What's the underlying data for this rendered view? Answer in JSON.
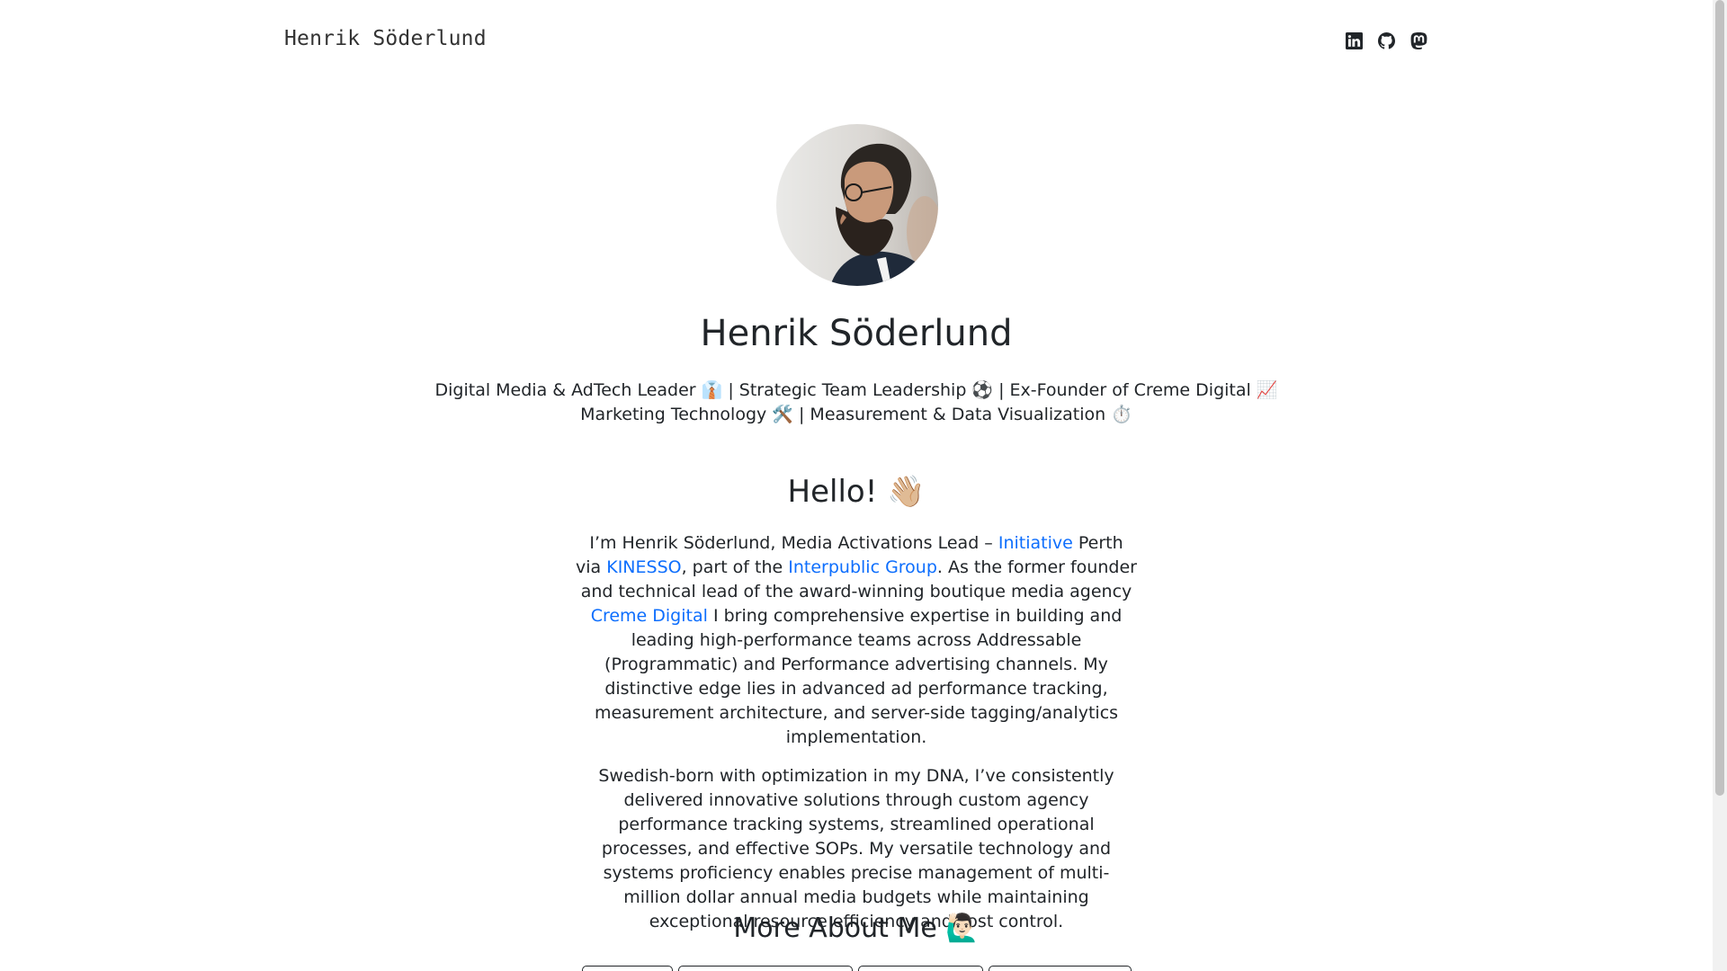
{
  "header": {
    "site_title": "Henrik Söderlund",
    "social": [
      {
        "icon": "linkedin-icon"
      },
      {
        "icon": "github-icon"
      },
      {
        "icon": "mastodon-icon"
      }
    ]
  },
  "hero": {
    "name": "Henrik Söderlund",
    "tagline_line1": "Digital Media & AdTech Leader 👔 | Strategic Team Leadership ⚽ | Ex-Founder of Creme Digital 📈",
    "tagline_line2": "Marketing Technology 🛠️ | Measurement & Data Visualization ⏱️"
  },
  "about": {
    "heading": "Hello! 👋🏼",
    "p1_a": "I’m Henrik Söderlund, Media Activations Lead – ",
    "p1_link1": "Initiative",
    "p1_b": " Perth via ",
    "p1_link2": "KINESSO",
    "p1_c": ", part of the ",
    "p1_link3": "Interpublic Group",
    "p1_d": ". As the former founder and technical lead of the award-winning boutique media agency ",
    "p1_link4": "Creme Digital",
    "p1_e": " I bring comprehensive expertise in building and leading high-performance teams across Addressable (Programmatic) and Performance advertising channels. My distinctive edge lies in advanced ad performance tracking, measurement architecture, and server-side tagging/analytics implementation.",
    "p2": "Swedish-born with optimization in my DNA, I’ve consistently delivered innovative solutions through custom agency performance tracking systems, streamlined operational processes, and effective SOPs. My versatile technology and systems proficiency enables precise management of multi-million dollar annual media budgets while maintaining exceptional resource efficiency and cost control."
  },
  "more": {
    "heading": "More About Me 🙋🏻‍♂️",
    "buttons": [
      "",
      "",
      "",
      ""
    ]
  },
  "colors": {
    "link": "#0d6efd",
    "text": "#212529"
  }
}
